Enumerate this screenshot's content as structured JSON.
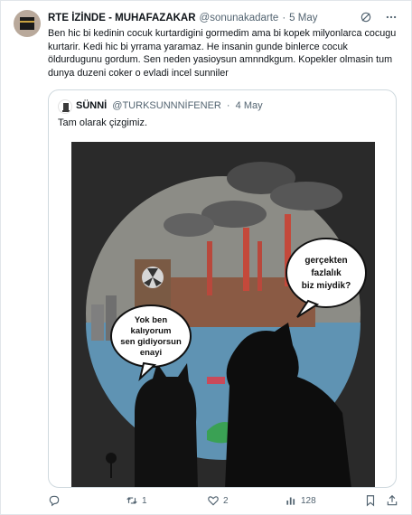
{
  "tweet": {
    "author_name": "RTE İZİNDE - MUHAFAZAKAR",
    "handle": "@sonunakadarte",
    "separator": "·",
    "date": "5 May",
    "text": "Ben hic bi kedinin cocuk kurtardigini gormedim ama bi kopek milyonlarca cocugu kurtarir. Kedi hic bi yrrama yaramaz. He insanin gunde binlerce cocuk öldurdugunu gordum. Sen neden yasioysun amnndkgum. Kopekler olmasin tum dunya duzeni coker o evladi incel sunniler"
  },
  "quote": {
    "author_name": "SÜNNİ",
    "handle": "@TURKSUNNNİFENER",
    "separator": "·",
    "date": "4 May",
    "text": "Tam olarak çizgimiz.",
    "image": {
      "bubble_left": [
        "Yok ben",
        "kalıyorum",
        "sen gidiyorsun",
        "enayi"
      ],
      "bubble_right": [
        "gerçekten",
        "fazlalık",
        "biz miydik?"
      ]
    }
  },
  "actions": {
    "reply_count": "",
    "retweet_count": "1",
    "like_count": "2",
    "views_count": "128"
  },
  "icons": {
    "header": [
      "grok-icon",
      "more-icon"
    ],
    "actions": [
      "reply-icon",
      "retweet-icon",
      "like-icon",
      "views-icon",
      "bookmark-icon",
      "share-icon"
    ]
  },
  "colors": {
    "text": "#0f1419",
    "secondary": "#536471",
    "border": "#cfd9de"
  }
}
